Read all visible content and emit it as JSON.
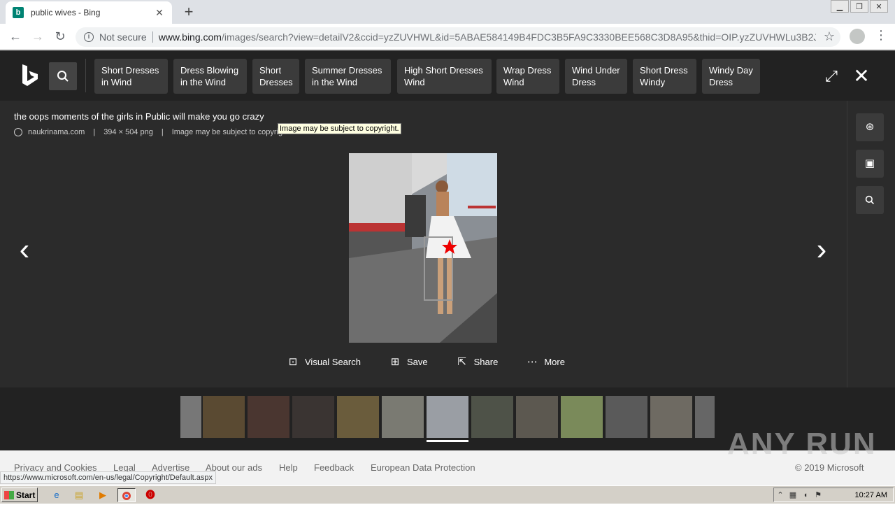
{
  "tab": {
    "title": "public wives - Bing",
    "favicon": "b"
  },
  "address": {
    "not_secure": "Not secure",
    "url_host": "www.bing.com",
    "url_path": "/images/search?view=detailV2&ccid=yzZUVHWL&id=5ABAE584149B4FDC3B5FA9C3330BEE568C3D8A95&thid=OIP.yzZUVHWLu3B2J_..."
  },
  "related_searches": [
    {
      "line1": "Short Dresses",
      "line2": "in Wind"
    },
    {
      "line1": "Dress Blowing",
      "line2": "in the Wind"
    },
    {
      "line1": "Short",
      "line2": "Dresses"
    },
    {
      "line1": "Summer Dresses",
      "line2": "in the Wind"
    },
    {
      "line1": "High Short Dresses",
      "line2": "Wind"
    },
    {
      "line1": "Wrap Dress",
      "line2": "Wind"
    },
    {
      "line1": "Wind Under",
      "line2": "Dress"
    },
    {
      "line1": "Short Dress",
      "line2": "Windy"
    },
    {
      "line1": "Windy Day",
      "line2": "Dress"
    }
  ],
  "image": {
    "title": "the oops moments of the girls in Public will make you go crazy",
    "source": "naukrinama.com",
    "dimensions": "394 × 504 png",
    "copyright": "Image may be subject to copyright.",
    "tooltip": "Image may be subject to copyright."
  },
  "actions": {
    "visual_search": "Visual Search",
    "save": "Save",
    "share": "Share",
    "more": "More"
  },
  "footer": {
    "links": [
      "Privacy and Cookies",
      "Legal",
      "Advertise",
      "About our ads",
      "Help",
      "Feedback",
      "European Data Protection"
    ],
    "copyright": "© 2019 Microsoft",
    "status_url": "https://www.microsoft.com/en-us/legal/Copyright/Default.aspx",
    "watermark": "ANY RUN"
  },
  "taskbar": {
    "start": "Start",
    "clock": "10:27 AM"
  }
}
